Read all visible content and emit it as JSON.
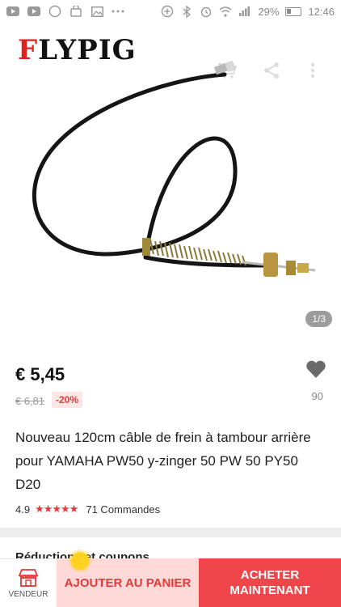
{
  "status_bar": {
    "battery": "29%",
    "time": "12:46"
  },
  "header": {
    "logo_text": "FLYPIG",
    "logo_first": "F"
  },
  "gallery": {
    "counter": "1/3"
  },
  "product": {
    "price": "€ 5,45",
    "old_price": "€ 6,81",
    "discount": "-20%",
    "wishlist_count": "90",
    "title": "Nouveau 120cm câble de frein à tambour arrière pour YAMAHA PW50 y-zinger 50 PW 50 PY50 D20",
    "rating": "4.9",
    "stars": "★★★★★",
    "orders": "71 Commandes"
  },
  "section": {
    "coupon_title": "Réductions et coupons"
  },
  "bottom_bar": {
    "vendor_label": "VENDEUR",
    "add_to_cart": "AJOUTER AU PANIER",
    "buy_now": "ACHETER\nMAINTENANT"
  },
  "colors": {
    "accent": "#f0454a",
    "accent_light": "#ffd8d8",
    "star": "#e53a3a"
  }
}
